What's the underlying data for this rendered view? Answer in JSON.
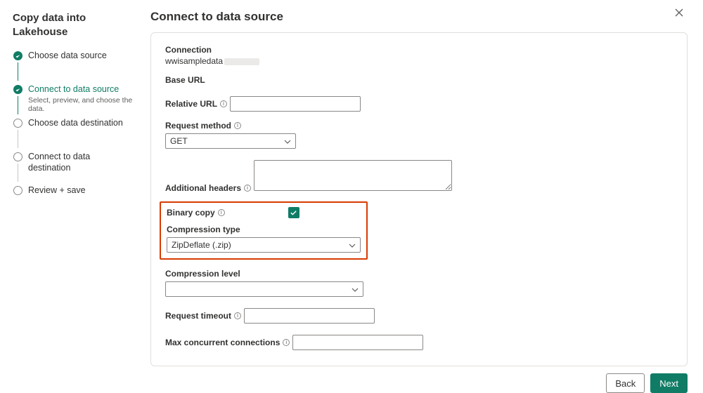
{
  "wizard_title": "Copy data into Lakehouse",
  "steps": [
    {
      "label": "Choose data source",
      "desc": "",
      "state": "done"
    },
    {
      "label": "Connect to data source",
      "desc": "Select, preview, and choose the data.",
      "state": "active"
    },
    {
      "label": "Choose data destination",
      "desc": "",
      "state": "pending"
    },
    {
      "label": "Connect to data destination",
      "desc": "",
      "state": "pending"
    },
    {
      "label": "Review + save",
      "desc": "",
      "state": "pending"
    }
  ],
  "main_title": "Connect to data source",
  "form": {
    "connection_label": "Connection",
    "connection_value": "wwisampledata",
    "base_url_label": "Base URL",
    "relative_url_label": "Relative URL",
    "relative_url_value": "",
    "request_method_label": "Request method",
    "request_method_value": "GET",
    "additional_headers_label": "Additional headers",
    "additional_headers_value": "",
    "binary_copy_label": "Binary copy",
    "binary_copy_checked": true,
    "compression_type_label": "Compression type",
    "compression_type_value": "ZipDeflate (.zip)",
    "compression_level_label": "Compression level",
    "compression_level_value": "",
    "request_timeout_label": "Request timeout",
    "request_timeout_value": "",
    "max_concurrent_label": "Max concurrent connections",
    "max_concurrent_value": ""
  },
  "buttons": {
    "back": "Back",
    "next": "Next"
  }
}
